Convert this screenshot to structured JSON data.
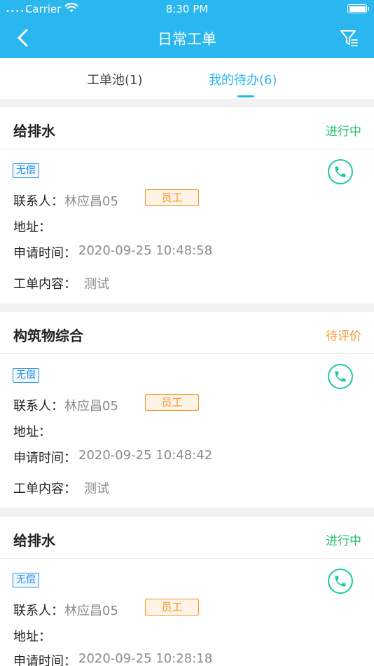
{
  "status_bar": {
    "carrier": "Carrier",
    "time": "8:30 PM",
    "dots": "•••••"
  },
  "nav": {
    "title": "日常工单"
  },
  "tabs": [
    {
      "label": "工单池(1)",
      "active": false
    },
    {
      "label": "我的待办(6)",
      "active": true
    }
  ],
  "field_labels": {
    "contact": "联系人：",
    "address": "地址：",
    "apply_time": "申请时间：",
    "content": "工单内容："
  },
  "orders": [
    {
      "title": "给排水",
      "status": "进行中",
      "fee_type": "无偿",
      "contact": "林应昌05",
      "role": "员工",
      "address": "",
      "apply_time": "2020-09-25 10:48:58",
      "content": "测试"
    },
    {
      "title": "构筑物综合",
      "status": "待评价",
      "fee_type": "无偿",
      "contact": "林应昌05",
      "role": "员工",
      "address": "",
      "apply_time": "2020-09-25 10:48:42",
      "content": "测试"
    },
    {
      "title": "给排水",
      "status": "进行中",
      "fee_type": "无偿",
      "contact": "林应昌05",
      "role": "员工",
      "address": "",
      "apply_time": "2020-09-25 10:28:18",
      "content": ""
    }
  ],
  "colors": {
    "brand": "#2ab6ef",
    "status_in_progress": "#27c36d",
    "status_pending_eval": "#f2962a",
    "phone": "#1ec9a5"
  }
}
